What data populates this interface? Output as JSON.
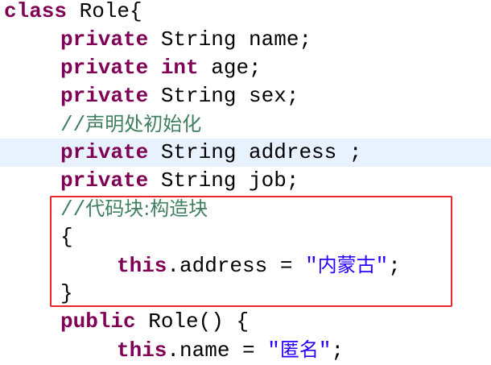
{
  "editor": {
    "lines": [
      {
        "indent": 0,
        "segments": [
          {
            "t": "class",
            "c": "kw"
          },
          {
            "t": " Role{",
            "c": "plain"
          }
        ]
      },
      {
        "indent": 1,
        "segments": [
          {
            "t": "private",
            "c": "kw"
          },
          {
            "t": " String name;",
            "c": "plain"
          }
        ]
      },
      {
        "indent": 1,
        "segments": [
          {
            "t": "private",
            "c": "kw"
          },
          {
            "t": " ",
            "c": "plain"
          },
          {
            "t": "int",
            "c": "kw"
          },
          {
            "t": " age;",
            "c": "plain"
          }
        ]
      },
      {
        "indent": 1,
        "segments": [
          {
            "t": "private",
            "c": "kw"
          },
          {
            "t": " String sex;",
            "c": "plain"
          }
        ]
      },
      {
        "indent": 1,
        "segments": [
          {
            "t": "//",
            "c": "comment"
          },
          {
            "t": "声明处初始化",
            "c": "comment cjk"
          }
        ]
      },
      {
        "indent": 1,
        "current": true,
        "segments": [
          {
            "t": "private",
            "c": "kw"
          },
          {
            "t": " String address ;",
            "c": "plain"
          }
        ]
      },
      {
        "indent": 1,
        "segments": [
          {
            "t": "private",
            "c": "kw"
          },
          {
            "t": " String job;",
            "c": "plain"
          }
        ]
      },
      {
        "indent": 1,
        "segments": [
          {
            "t": "//",
            "c": "comment"
          },
          {
            "t": "代码块:构造块",
            "c": "comment cjk"
          }
        ]
      },
      {
        "indent": 1,
        "segments": [
          {
            "t": "{",
            "c": "plain"
          }
        ]
      },
      {
        "indent": 2,
        "segments": [
          {
            "t": "this",
            "c": "kw"
          },
          {
            "t": ".address = ",
            "c": "plain"
          },
          {
            "t": "\"",
            "c": "str"
          },
          {
            "t": "内蒙古",
            "c": "str cjk"
          },
          {
            "t": "\"",
            "c": "str"
          },
          {
            "t": ";",
            "c": "plain"
          }
        ]
      },
      {
        "indent": 1,
        "segments": [
          {
            "t": "}",
            "c": "plain"
          }
        ]
      },
      {
        "indent": 1,
        "segments": [
          {
            "t": "public",
            "c": "kw"
          },
          {
            "t": " Role() {",
            "c": "plain"
          }
        ]
      },
      {
        "indent": 2,
        "segments": [
          {
            "t": "this",
            "c": "kw"
          },
          {
            "t": ".name = ",
            "c": "plain"
          },
          {
            "t": "\"",
            "c": "str"
          },
          {
            "t": "匿名",
            "c": "str cjk"
          },
          {
            "t": "\"",
            "c": "str"
          },
          {
            "t": ";",
            "c": "plain"
          }
        ]
      }
    ]
  },
  "colors": {
    "keyword": "#7f0055",
    "comment": "#3f7f5f",
    "string": "#2a00ff",
    "current_line": "#e8f2fe",
    "annotation_box": "#e8262d"
  }
}
